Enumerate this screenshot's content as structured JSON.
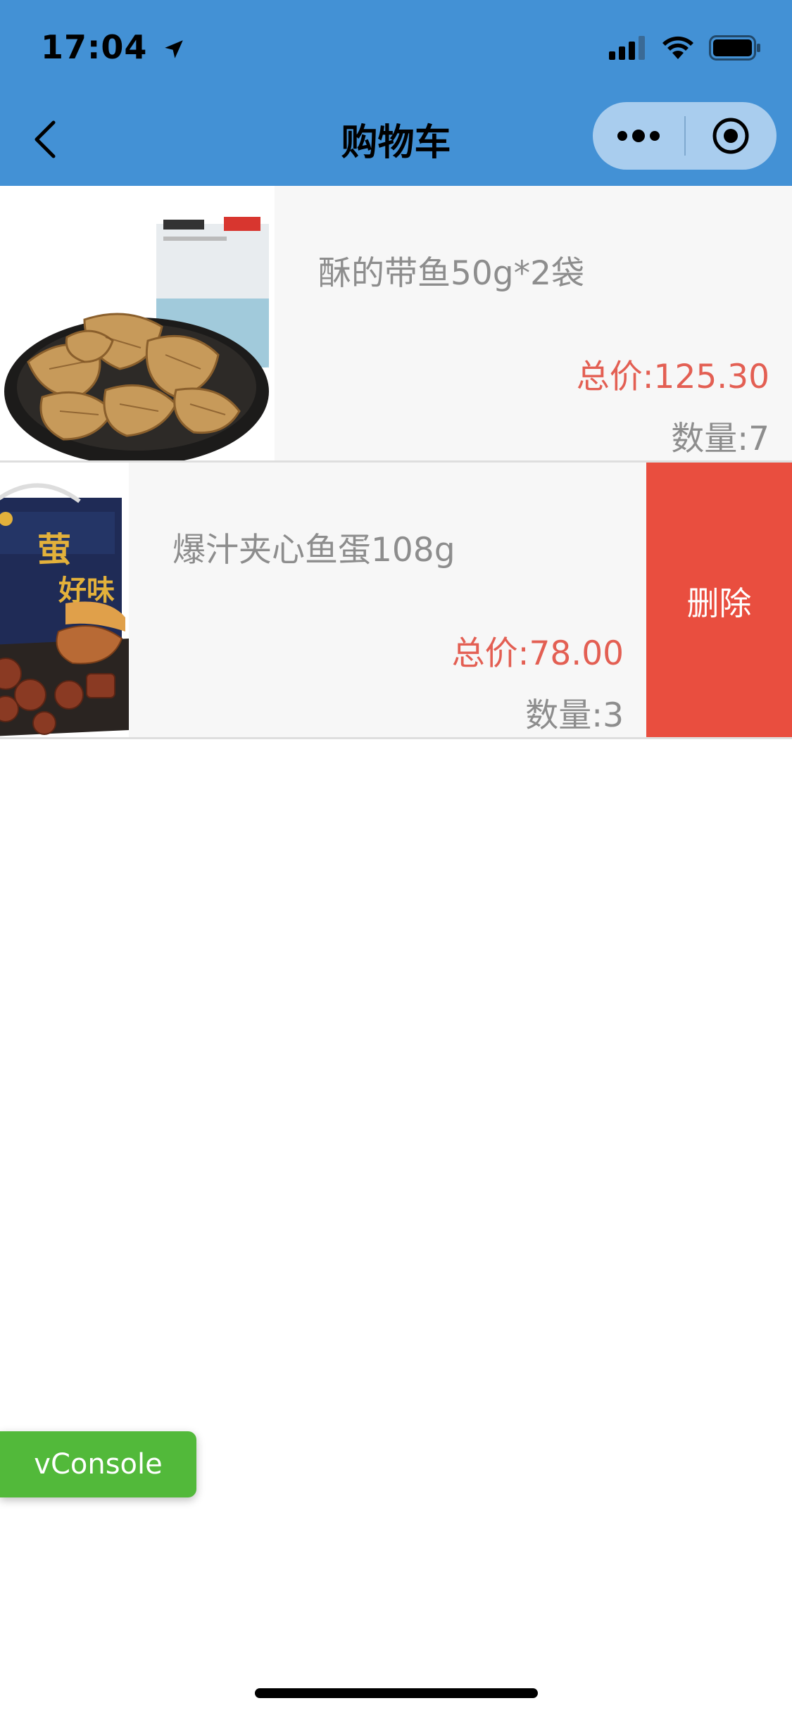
{
  "status_bar": {
    "time": "17:04",
    "icons": [
      "location-arrow-icon",
      "signal-icon",
      "wifi-icon",
      "battery-icon"
    ]
  },
  "nav": {
    "title": "购物车",
    "back_icon": "chevron-left-icon",
    "capsule_icons": [
      "more-dots-icon",
      "close-target-icon"
    ],
    "background": "#4391d5"
  },
  "cart": {
    "items": [
      {
        "name": "酥的带鱼50g*2袋",
        "price": "总价:125.30",
        "quantity": "数量:7"
      },
      {
        "name": "爆汁夹心鱼蛋108g",
        "price": "总价:78.00",
        "quantity": "数量:3",
        "delete_label": "删除"
      }
    ],
    "colors": {
      "price": "#e35f53",
      "delete": "#e94e3f"
    }
  },
  "vconsole": {
    "label": "vConsole",
    "color": "#52b93a"
  }
}
